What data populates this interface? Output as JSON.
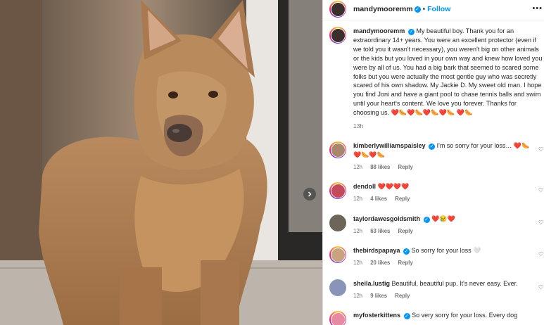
{
  "post": {
    "username": "mandymooremm",
    "follow_label": "Follow",
    "dot": "•",
    "more_label": "•••",
    "caption_text": "My beautiful boy. Thank you for an extraordinary 14+ years. You were an excellent protector (even if we told you it wasn't necessary), you weren't big on other animals or the kids but you loved in your own way and knew how loved you were by all of us. You had a big bark that seemed to scared some folks but you were actually the most gentle guy who was secretly scared of his own shadow. My Jackie D. My sweet old man. I hope you find Joni and have a giant pool to chase tennis balls and swim until your heart's content. We love you forever. Thanks for choosing us. ",
    "caption_emojis": "❤️🌭❤️🌭❤️🌭❤️🌭 ❤️🌭",
    "time": "13h"
  },
  "comments": [
    {
      "username": "kimberlywilliamspaisley",
      "verified": true,
      "text": "I'm so sorry for your loss… ❤️🌭 ❤️🌭❤️🌭",
      "time": "12h",
      "likes": "88 likes",
      "reply": "Reply"
    },
    {
      "username": "dendoll",
      "verified": false,
      "text": "❤️❤️❤️❤️",
      "time": "12h",
      "likes": "4 likes",
      "reply": "Reply"
    },
    {
      "username": "taylordawesgoldsmith",
      "verified": true,
      "text": "❤️😢❤️",
      "time": "12h",
      "likes": "63 likes",
      "reply": "Reply"
    },
    {
      "username": "thebirdspapaya",
      "verified": true,
      "text": "So sorry for your loss 🤍",
      "time": "12h",
      "likes": "20 likes",
      "reply": "Reply"
    },
    {
      "username": "sheila.lustig",
      "verified": false,
      "text": "Beautiful, beautiful pup. It's never easy. Ever.",
      "time": "12h",
      "likes": "9 likes",
      "reply": "Reply"
    },
    {
      "username": "myfosterkittens",
      "verified": true,
      "text": "So very sorry for your loss. Every dog",
      "time": "",
      "likes": "",
      "reply": ""
    }
  ],
  "icons": {
    "verified": "verified-badge-icon",
    "heart": "heart-outline-icon",
    "next": "chevron-right-icon"
  },
  "colors": {
    "accent": "#0095f6",
    "text": "#262626",
    "muted": "#737373"
  }
}
